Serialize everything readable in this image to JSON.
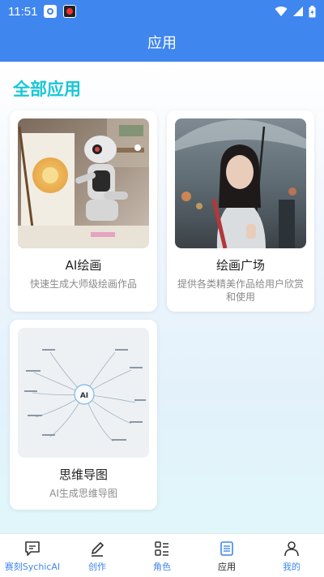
{
  "status_bar": {
    "time": "11:51"
  },
  "app_bar": {
    "title": "应用"
  },
  "section": {
    "title": "全部应用"
  },
  "cards": [
    {
      "title": "AI绘画",
      "desc": "快速生成大师级绘画作品"
    },
    {
      "title": "绘画广场",
      "desc": "提供各类精美作品给用户欣赏和使用"
    },
    {
      "title": "思维导图",
      "desc": "AI生成思维导图",
      "image_label": "AI"
    }
  ],
  "bottom_nav": {
    "items": [
      {
        "label": "赛刻SychicAI",
        "icon": "chat-icon"
      },
      {
        "label": "创作",
        "icon": "pencil-icon"
      },
      {
        "label": "角色",
        "icon": "roles-icon"
      },
      {
        "label": "应用",
        "icon": "apps-icon",
        "active": true
      },
      {
        "label": "我的",
        "icon": "person-icon"
      }
    ]
  },
  "colors": {
    "primary": "#3f86ee",
    "section_title": "#19c6d6",
    "nav_active_label": "#222222"
  }
}
